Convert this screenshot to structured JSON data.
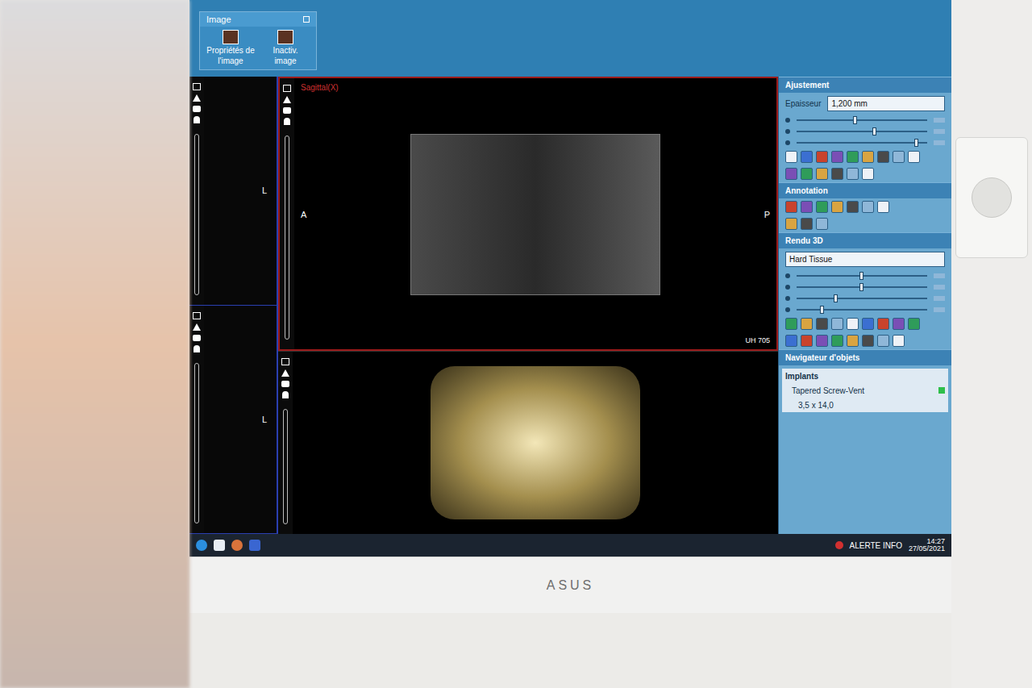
{
  "toolbar": {
    "group": "Image",
    "buttons": [
      "Propriétés de l'image",
      "Inactiv. image"
    ]
  },
  "side_view": {
    "labels": [
      "L",
      "L"
    ]
  },
  "sagittal": {
    "title": "Sagittal(X)",
    "left": "A",
    "right": "P",
    "reading": "UH 705"
  },
  "panel": {
    "adjust": {
      "title": "Ajustement",
      "field_label": "Epaisseur",
      "field_value": "1,200 mm",
      "sliders": [
        {
          "level": 0.45
        },
        {
          "level": 0.6
        },
        {
          "level": 0.92
        }
      ]
    },
    "annotation": {
      "title": "Annotation"
    },
    "render": {
      "title": "Rendu 3D",
      "preset": "Hard Tissue",
      "sliders": [
        {
          "level": 0.5
        },
        {
          "level": 0.5
        },
        {
          "level": 0.3
        },
        {
          "level": 0.2
        }
      ]
    },
    "objects": {
      "title": "Navigateur d'objets",
      "items": [
        {
          "label": "Implants",
          "kind": "group",
          "visible": false
        },
        {
          "label": "Tapered Screw-Vent",
          "kind": "implant",
          "visible": true
        },
        {
          "label": "3,5 x 14,0",
          "kind": "detail",
          "visible": false
        }
      ]
    }
  },
  "taskbar": {
    "notification": "ALERTE INFO",
    "time": "14:27",
    "date": "27/05/2021"
  },
  "monitor": {
    "brand": "ASUS"
  }
}
